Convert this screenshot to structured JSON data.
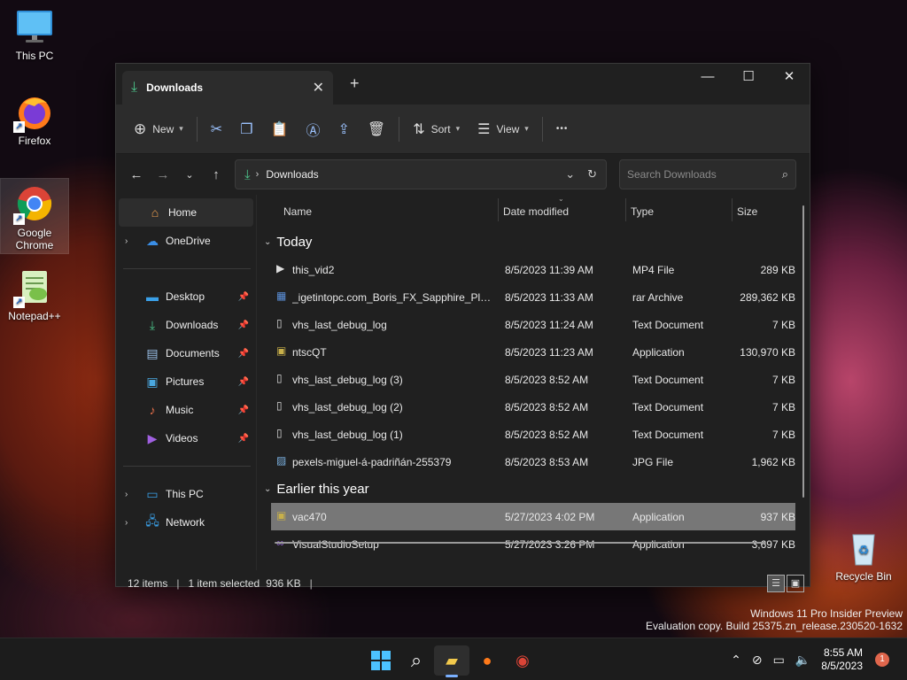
{
  "desktop": {
    "icons": [
      {
        "label": "This PC"
      },
      {
        "label": "Firefox"
      },
      {
        "label": "Google Chrome"
      },
      {
        "label": "Notepad++"
      },
      {
        "label": "Recycle Bin"
      }
    ],
    "watermark": {
      "line1": "Windows 11 Pro Insider Preview",
      "line2": "Evaluation copy. Build 25375.zn_release.230520-1632"
    }
  },
  "window": {
    "tab_title": "Downloads",
    "new_tab": "+",
    "toolbar": {
      "new_label": "New",
      "sort_label": "Sort",
      "view_label": "View",
      "more_label": "•••"
    },
    "address": {
      "crumb": "Downloads"
    },
    "search": {
      "placeholder": "Search Downloads"
    },
    "nav": {
      "home": "Home",
      "onedrive": "OneDrive",
      "desktop": "Desktop",
      "downloads": "Downloads",
      "documents": "Documents",
      "pictures": "Pictures",
      "music": "Music",
      "videos": "Videos",
      "thispc": "This PC",
      "network": "Network"
    },
    "columns": {
      "name": "Name",
      "date": "Date modified",
      "type": "Type",
      "size": "Size"
    },
    "groups": {
      "today": "Today",
      "earlier": "Earlier this year"
    },
    "files_today": [
      {
        "name": "this_vid2",
        "date": "8/5/2023 11:39 AM",
        "type": "MP4 File",
        "size": "289 KB",
        "icon": "video-file-icon"
      },
      {
        "name": "_igetintopc.com_Boris_FX_Sapphire_Plug...",
        "date": "8/5/2023 11:33 AM",
        "type": "rar Archive",
        "size": "289,362 KB",
        "icon": "archive-file-icon"
      },
      {
        "name": "vhs_last_debug_log",
        "date": "8/5/2023 11:24 AM",
        "type": "Text Document",
        "size": "7 KB",
        "icon": "text-file-icon"
      },
      {
        "name": "ntscQT",
        "date": "8/5/2023 11:23 AM",
        "type": "Application",
        "size": "130,970 KB",
        "icon": "app-icon"
      },
      {
        "name": "vhs_last_debug_log (3)",
        "date": "8/5/2023 8:52 AM",
        "type": "Text Document",
        "size": "7 KB",
        "icon": "text-file-icon"
      },
      {
        "name": "vhs_last_debug_log (2)",
        "date": "8/5/2023 8:52 AM",
        "type": "Text Document",
        "size": "7 KB",
        "icon": "text-file-icon"
      },
      {
        "name": "vhs_last_debug_log (1)",
        "date": "8/5/2023 8:52 AM",
        "type": "Text Document",
        "size": "7 KB",
        "icon": "text-file-icon"
      },
      {
        "name": "pexels-miguel-á-padriñán-255379",
        "date": "8/5/2023 8:53 AM",
        "type": "JPG File",
        "size": "1,962 KB",
        "icon": "image-file-icon"
      }
    ],
    "files_earlier": [
      {
        "name": "vac470",
        "date": "5/27/2023 4:02 PM",
        "type": "Application",
        "size": "937 KB",
        "icon": "app-icon"
      },
      {
        "name": "VisualStudioSetup",
        "date": "5/27/2023 3:26 PM",
        "type": "Application",
        "size": "3,697 KB",
        "icon": "visual-studio-icon"
      }
    ],
    "status": {
      "count": "12 items",
      "selected": "1 item selected",
      "sel_size": "936 KB"
    }
  },
  "taskbar": {
    "time": "8:55 AM",
    "date": "8/5/2023",
    "notif_count": "1"
  }
}
